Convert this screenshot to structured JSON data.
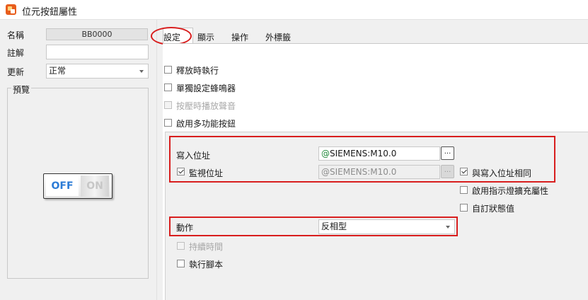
{
  "window": {
    "title": "位元按鈕屬性"
  },
  "left": {
    "name_label": "名稱",
    "name_value": "BB0000",
    "note_label": "註解",
    "note_value": "",
    "update_label": "更新",
    "update_value": "正常",
    "preview_label": "預覽",
    "preview_off": "OFF",
    "preview_on": "ON"
  },
  "tabs": [
    {
      "label": "設定",
      "active": true
    },
    {
      "label": "顯示",
      "active": false
    },
    {
      "label": "操作",
      "active": false
    },
    {
      "label": "外標籤",
      "active": false
    }
  ],
  "options": [
    {
      "label": "釋放時執行",
      "checked": false,
      "disabled": false
    },
    {
      "label": "單獨設定蜂鳴器",
      "checked": false,
      "disabled": false
    },
    {
      "label": "按壓時播放聲音",
      "checked": false,
      "disabled": true
    },
    {
      "label": "啟用多功能按鈕",
      "checked": false,
      "disabled": false
    }
  ],
  "write_address": {
    "label": "寫入位址",
    "prefix": "@",
    "value": "SIEMENS:M10.0",
    "browse": "..."
  },
  "monitor_address": {
    "label": "監視位址",
    "checked": true,
    "value": "@SIEMENS:M10.0",
    "browse": "...",
    "same_label": "與寫入位址相同",
    "same_checked": true
  },
  "extra_options": [
    {
      "label": "啟用指示燈擴充屬性",
      "checked": false
    },
    {
      "label": "自訂狀態值",
      "checked": false
    }
  ],
  "action": {
    "label": "動作",
    "value": "反相型"
  },
  "bottom_options": [
    {
      "label": "持續時間",
      "checked": false,
      "disabled": true
    },
    {
      "label": "執行腳本",
      "checked": false,
      "disabled": false
    }
  ],
  "colors": {
    "highlight": "#d81e1e",
    "address_prefix": "#1f8a3a",
    "toggle_off": "#2b7bd6"
  }
}
